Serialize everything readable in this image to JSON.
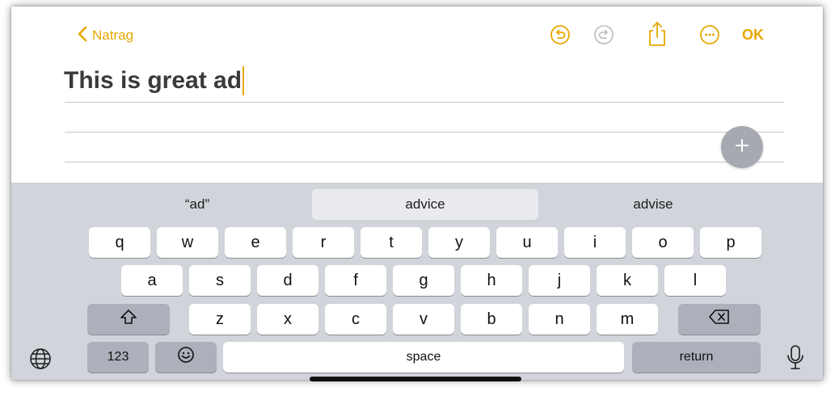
{
  "topbar": {
    "back_label": "Natrag",
    "done_label": "OK",
    "icons": [
      "undo-icon",
      "redo-icon",
      "share-icon",
      "more-icon"
    ]
  },
  "note": {
    "title_text": "This is great ad"
  },
  "keyboard": {
    "suggestions": [
      "“ad”",
      "advice",
      "advise"
    ],
    "row1": [
      "q",
      "w",
      "e",
      "r",
      "t",
      "y",
      "u",
      "i",
      "o",
      "p"
    ],
    "row2": [
      "a",
      "s",
      "d",
      "f",
      "g",
      "h",
      "j",
      "k",
      "l"
    ],
    "row3": [
      "z",
      "x",
      "c",
      "v",
      "b",
      "n",
      "m"
    ],
    "numbers_label": "123",
    "space_label": "space",
    "return_label": "return"
  },
  "colors": {
    "accent": "#e6a800",
    "keyboard_bg": "#d1d4da",
    "key_dark": "#abb0ba"
  }
}
